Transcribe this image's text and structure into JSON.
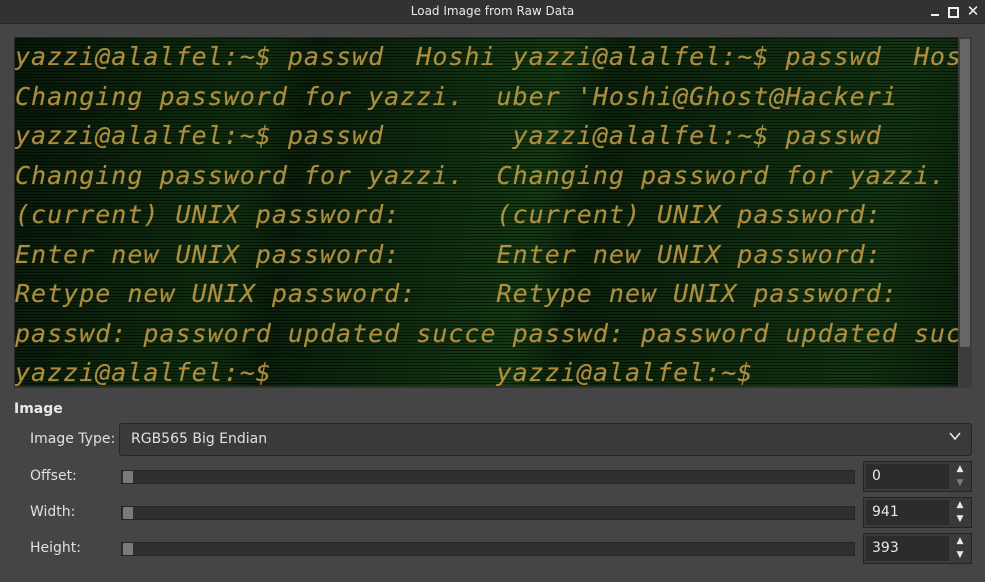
{
  "window": {
    "title": "Load Image from Raw Data",
    "controls": [
      "minimize",
      "maximize",
      "close"
    ]
  },
  "preview": {
    "lines": [
      "yazzi@alalfel:~$ passwd  Hoshi yazzi@alalfel:~$ passwd  Hoshi",
      "Changing password for yazzi.  uber 'Hoshi@Ghost@Hackeri",
      "yazzi@alalfel:~$ passwd        yazzi@alalfel:~$ passwd      yaz",
      "Changing password for yazzi.  Changing password for yazzi.  Cha",
      "(current) UNIX password:      (current) UNIX password:      (cu",
      "Enter new UNIX password:      Enter new UNIX password:      Ent",
      "Retype new UNIX password:     Retype new UNIX password:     Ret",
      "passwd: password updated succe passwd: password updated succe",
      "yazzi@alalfel:~$              yazzi@alalfel:~$              yaz"
    ]
  },
  "image_section": {
    "heading": "Image",
    "image_type_label": "Image Type:",
    "image_type_value": "RGB565 Big Endian",
    "offset_label": "Offset:",
    "offset_value": "0",
    "width_label": "Width:",
    "width_value": "941",
    "height_label": "Height:",
    "height_value": "393"
  },
  "colors": {
    "background": "#454545",
    "preview_green": "#0d2a0d",
    "preview_text": "#c8a24a"
  }
}
